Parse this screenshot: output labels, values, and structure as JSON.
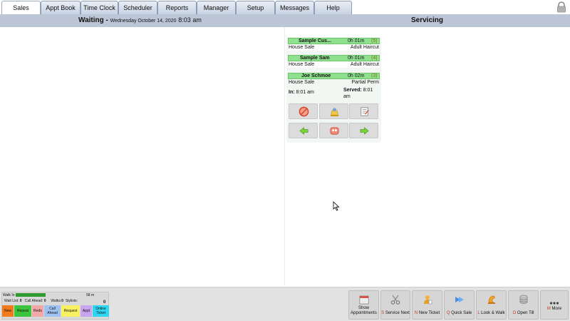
{
  "tabs": [
    {
      "label": "Sales",
      "active": true
    },
    {
      "label": "Appt Book"
    },
    {
      "label": "Time Clock"
    },
    {
      "label": "Scheduler"
    },
    {
      "label": "Reports"
    },
    {
      "label": "Manager"
    },
    {
      "label": "Setup"
    },
    {
      "label": "Messages"
    },
    {
      "label": "Help"
    }
  ],
  "header": {
    "waiting_label": "Waiting -",
    "date": "Wednesday October 14, 2020",
    "time": "8:03 am",
    "servicing_label": "Servicing"
  },
  "tickets": [
    {
      "name": "Sample Cus...",
      "elapsed": "0h 01m",
      "number": "(5)",
      "sale": "House Sale",
      "service": "Adult Haircut"
    },
    {
      "name": "Sample Sam",
      "elapsed": "0h 01m",
      "number": "(4)",
      "sale": "House Sale",
      "service": "Adult Haircut"
    },
    {
      "name": "Joe Schmoe",
      "elapsed": "0h 02m",
      "number": "(3)",
      "sale": "House Sale",
      "service": "Partial Perm"
    }
  ],
  "ticket_times": {
    "in_label": "In:",
    "in_time": "8:01 am",
    "served_label": "Served:",
    "served_time": "8:01",
    "served_suffix": "am"
  },
  "action_icons": [
    "no-sign-icon",
    "stylist-bell-icon",
    "notes-icon",
    "arrow-left-icon",
    "group-icon",
    "arrow-right-icon"
  ],
  "wait_panel": {
    "walkin_label": "Walk In",
    "walkin_minutes": "58 m",
    "wait_list_label": "Wait List:",
    "wait_list_value": "0",
    "call_ahead_label": "Call Ahead:",
    "call_ahead_value": "0",
    "walks_label": "Walks:",
    "walks_value": "0",
    "stylists_label": "Stylists:",
    "total": "0"
  },
  "legend": [
    {
      "label": "New",
      "color": "#f27a1a"
    },
    {
      "label": "Repeat",
      "color": "#3cc43c"
    },
    {
      "label": "Redo",
      "color": "#f3a7a7"
    },
    {
      "label": "Call Ahead",
      "color": "#9fc3f0"
    },
    {
      "label": "Request",
      "color": "#f7f060"
    },
    {
      "label": "Appt",
      "color": "#c9a4ef"
    },
    {
      "label": "Online Ticket",
      "color": "#2ed6f2"
    }
  ],
  "bottom_buttons": [
    {
      "hotkey": "",
      "label": "Show Appointments",
      "icon": "calendar-icon"
    },
    {
      "hotkey": "S",
      "label": "Service Next",
      "icon": "scissors-icon"
    },
    {
      "hotkey": "N",
      "label": "New Ticket",
      "icon": "new-ticket-icon"
    },
    {
      "hotkey": "Q",
      "label": "Quick Sale",
      "icon": "quick-sale-icon"
    },
    {
      "hotkey": "L",
      "label": "Look & Walk",
      "icon": "look-walk-icon"
    },
    {
      "hotkey": "O",
      "label": "Open Till",
      "icon": "till-icon"
    },
    {
      "hotkey": "M",
      "label": "More",
      "icon": "more-icon"
    }
  ]
}
